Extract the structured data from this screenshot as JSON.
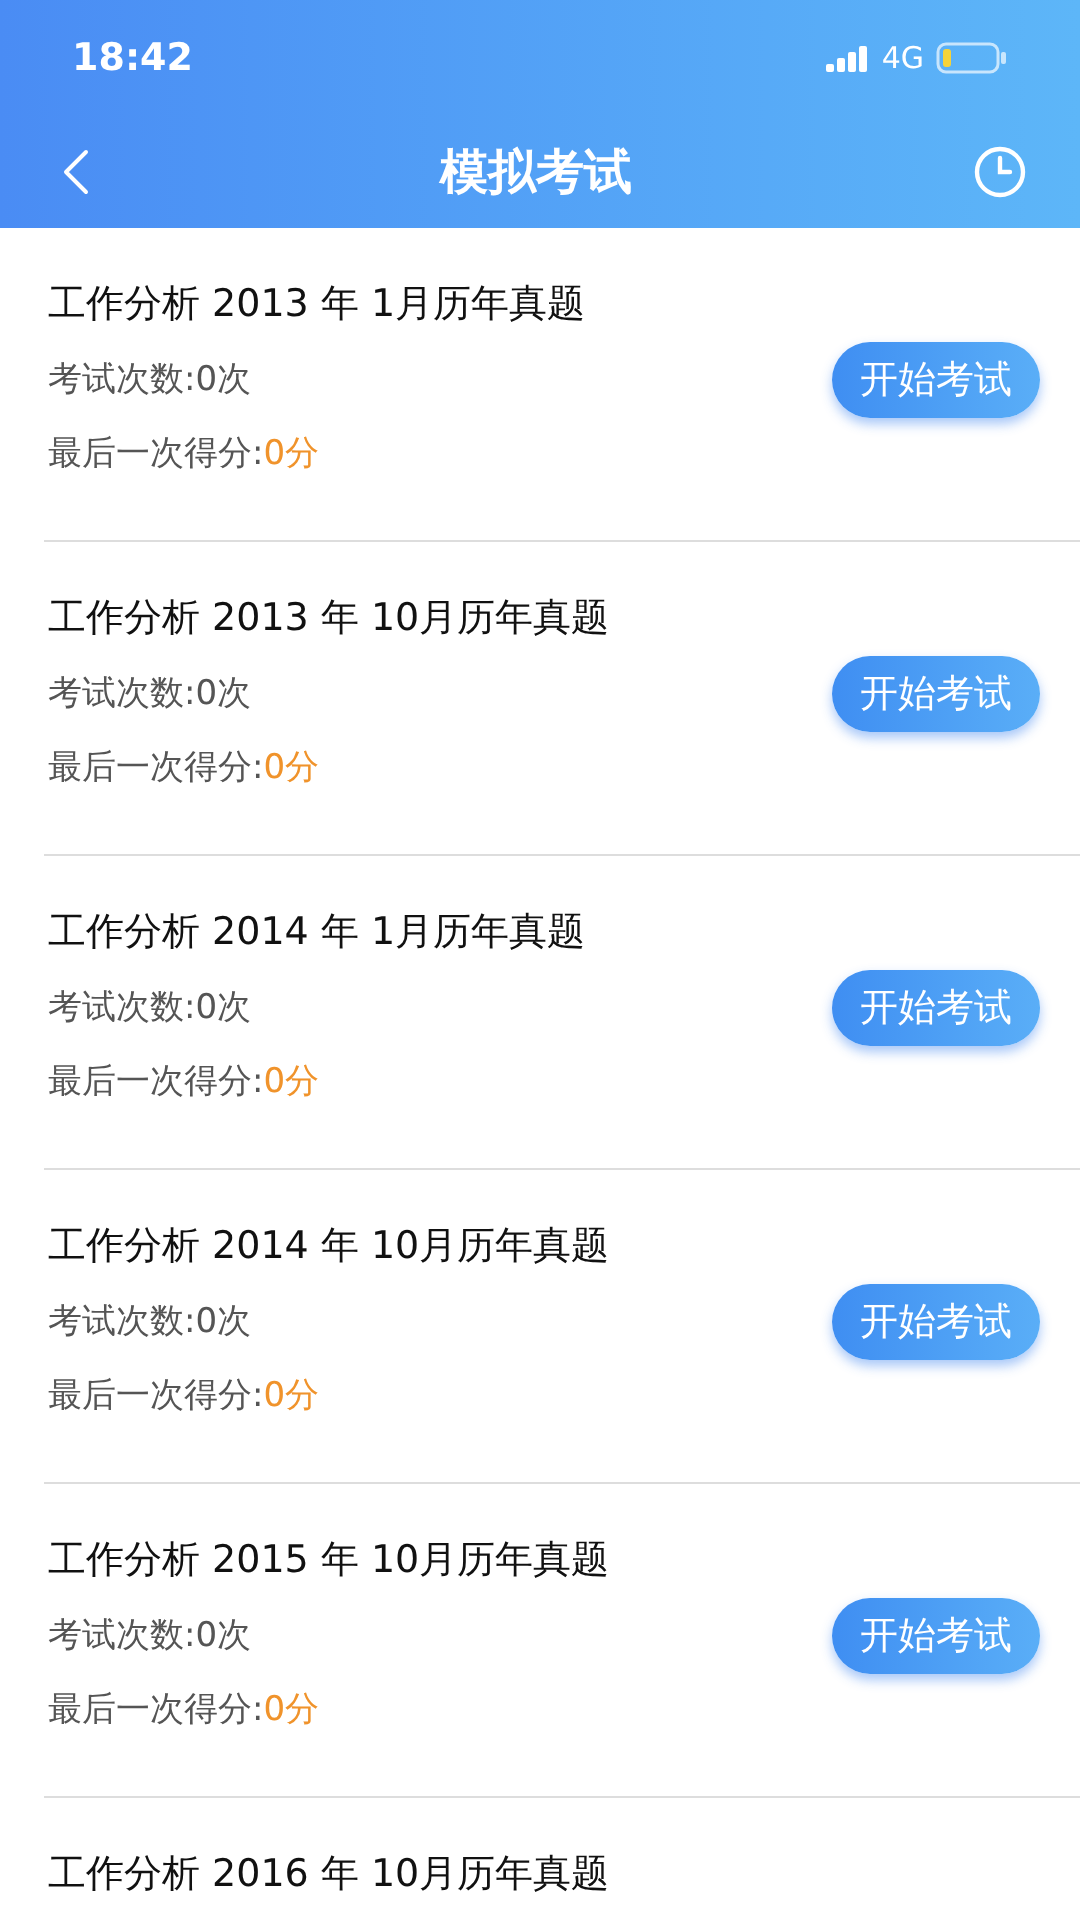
{
  "status_bar": {
    "time": "18:42",
    "network": "4G"
  },
  "header": {
    "title": "模拟考试"
  },
  "exams": [
    {
      "title": "工作分析 2013 年 1月历年真题",
      "count": "考试次数:0次",
      "score_label": "最后一次得分:",
      "score": "0分",
      "button": "开始考试"
    },
    {
      "title": "工作分析 2013 年 10月历年真题",
      "count": "考试次数:0次",
      "score_label": "最后一次得分:",
      "score": "0分",
      "button": "开始考试"
    },
    {
      "title": "工作分析 2014 年 1月历年真题",
      "count": "考试次数:0次",
      "score_label": "最后一次得分:",
      "score": "0分",
      "button": "开始考试"
    },
    {
      "title": "工作分析 2014 年 10月历年真题",
      "count": "考试次数:0次",
      "score_label": "最后一次得分:",
      "score": "0分",
      "button": "开始考试"
    },
    {
      "title": "工作分析 2015 年 10月历年真题",
      "count": "考试次数:0次",
      "score_label": "最后一次得分:",
      "score": "0分",
      "button": "开始考试"
    },
    {
      "title": "工作分析 2016 年 10月历年真题"
    }
  ]
}
